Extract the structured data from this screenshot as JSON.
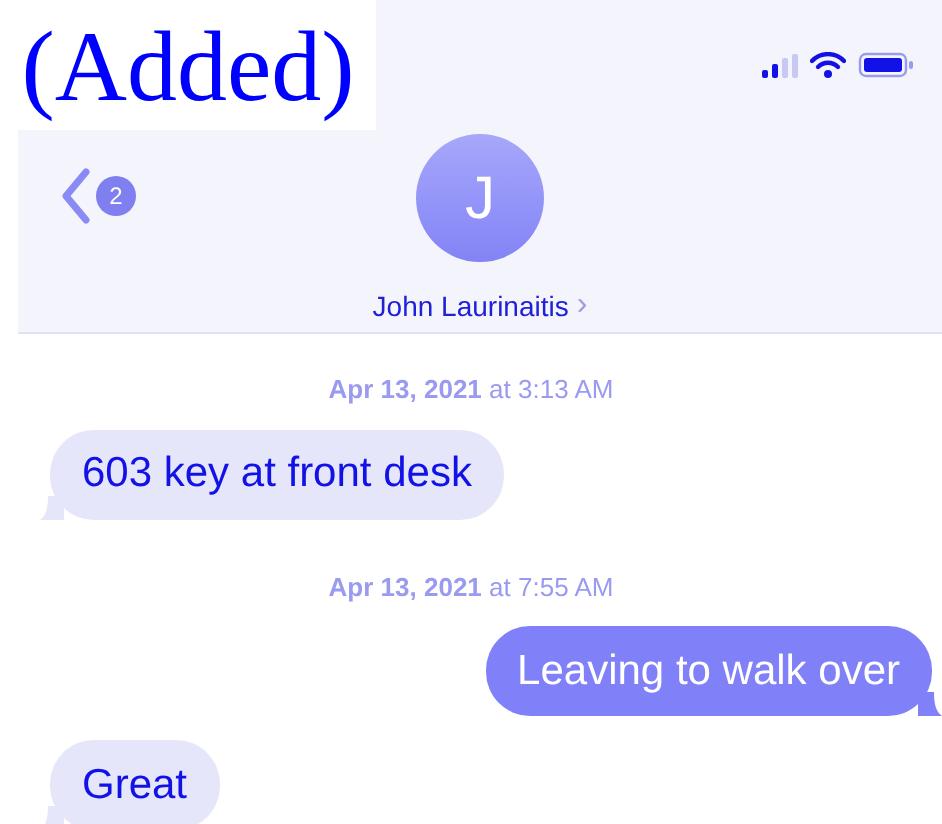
{
  "annotation": "(Added)",
  "header": {
    "back_badge": "2",
    "avatar_initial": "J",
    "contact_name": "John Laurinaitis",
    "contact_chevron": "›"
  },
  "thread": [
    {
      "kind": "timestamp",
      "date": "Apr 13, 2021",
      "word": "at",
      "time": "3:13 AM"
    },
    {
      "kind": "incoming",
      "text": "603 key at front desk"
    },
    {
      "kind": "timestamp",
      "date": "Apr 13, 2021",
      "word": "at",
      "time": "7:55 AM"
    },
    {
      "kind": "outgoing",
      "text": "Leaving to walk over"
    },
    {
      "kind": "incoming",
      "text": "Great"
    }
  ]
}
